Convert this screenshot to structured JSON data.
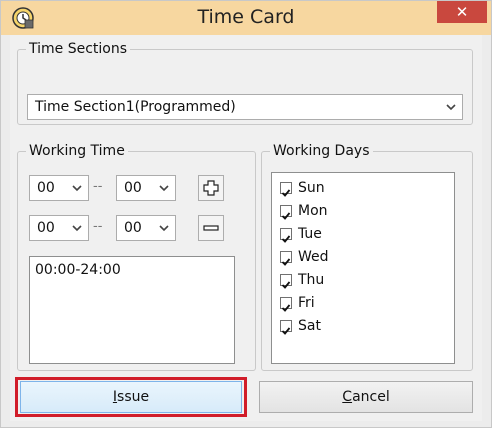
{
  "window": {
    "title": "Time Card",
    "close_label": "✕"
  },
  "time_sections": {
    "legend": "Time Sections",
    "selected": "Time Section1(Programmed)"
  },
  "working_time": {
    "legend": "Working Time",
    "row1": {
      "start": "00",
      "end": "00",
      "separator": "--"
    },
    "row2": {
      "start": "00",
      "end": "00",
      "separator": "--"
    },
    "add_label": "+",
    "remove_label": "−",
    "entries": [
      "00:00-24:00"
    ]
  },
  "working_days": {
    "legend": "Working Days",
    "days": [
      {
        "label": "Sun",
        "checked": true
      },
      {
        "label": "Mon",
        "checked": true
      },
      {
        "label": "Tue",
        "checked": true
      },
      {
        "label": "Wed",
        "checked": true
      },
      {
        "label": "Thu",
        "checked": true
      },
      {
        "label": "Fri",
        "checked": true
      },
      {
        "label": "Sat",
        "checked": true
      }
    ]
  },
  "buttons": {
    "issue": "Issue",
    "issue_mnemonic": "I",
    "cancel": "Cancel",
    "cancel_mnemonic": "C"
  },
  "colors": {
    "highlight": "#d11d2a",
    "titlebar": "#f7d7a0",
    "close": "#c9483e"
  }
}
